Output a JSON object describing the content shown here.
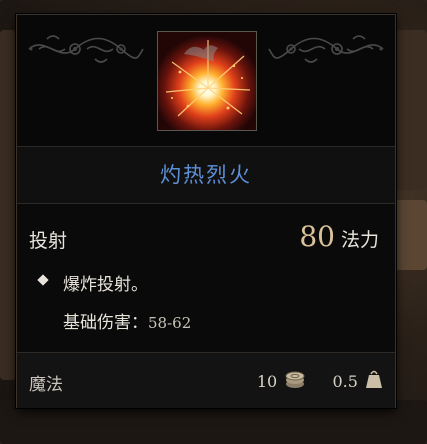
{
  "spell": {
    "icon": "fireball-explosion-icon",
    "name": "灼热烈火",
    "type": "投射",
    "cost_value": "80",
    "cost_unit": "法力",
    "effect": "爆炸投射。",
    "damage_label": "基础伤害：",
    "damage_value": "58-62"
  },
  "footer": {
    "school": "魔法",
    "price": "10",
    "price_icon": "coin-stack-icon",
    "weight": "0.5",
    "weight_icon": "weight-icon"
  },
  "colors": {
    "title": "#5d8fd6",
    "cost_number": "#d9c29a",
    "text": "#e8e4dc",
    "panel": "#0c0b0b"
  }
}
